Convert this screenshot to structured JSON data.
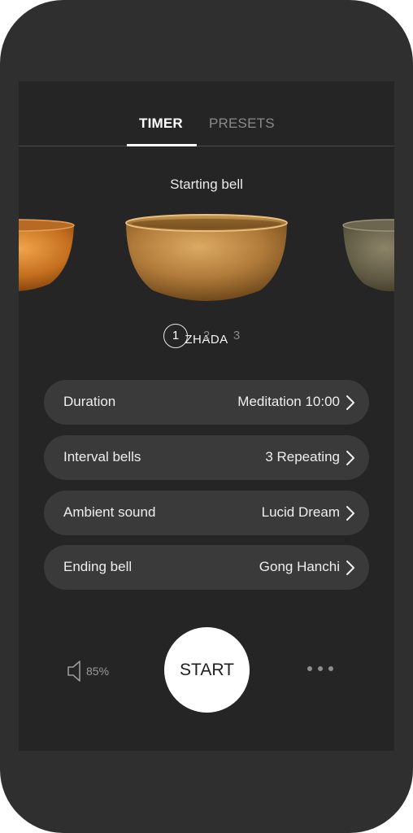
{
  "tabs": {
    "timer": "TIMER",
    "presets": "PRESETS"
  },
  "starting_bell": {
    "title": "Starting bell",
    "bowl_name": "ZHADA",
    "pages": [
      "1",
      "2",
      "3"
    ],
    "active_page": 1
  },
  "settings": [
    {
      "label": "Duration",
      "value": "Meditation 10:00"
    },
    {
      "label": "Interval bells",
      "value": "3 Repeating"
    },
    {
      "label": "Ambient sound",
      "value": "Lucid Dream"
    },
    {
      "label": "Ending bell",
      "value": "Gong Hanchi"
    }
  ],
  "controls": {
    "volume": "85%",
    "start": "START",
    "volume_icon": "speaker-icon",
    "more_icon": "more-horizontal-icon"
  },
  "colors": {
    "background": "#252525",
    "row_background": "#3a3a3a",
    "accent": "#ffffff",
    "muted": "#8a8a8a"
  }
}
